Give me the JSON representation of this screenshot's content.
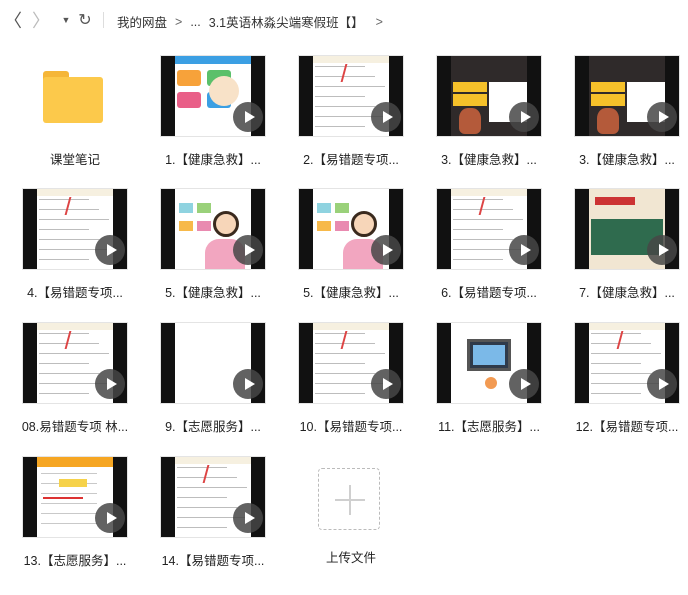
{
  "toolbar": {
    "back_glyph": "〈",
    "forward_glyph": "〉",
    "dropdown_glyph": "▼",
    "refresh_glyph": "↻"
  },
  "breadcrumb": {
    "root": "我的网盘",
    "sep1": ">",
    "ellipsis": "...",
    "current": "3.1英语林淼尖端寒假班【】",
    "sep2": ">"
  },
  "folder": {
    "label": "课堂笔记",
    "icon": "folder-icon"
  },
  "files": [
    {
      "label": "1.【健康急救】...",
      "theme": "infographic"
    },
    {
      "label": "2.【易错题专项...",
      "theme": "worksheet"
    },
    {
      "label": "3.【健康急救】...",
      "theme": "slide-dark"
    },
    {
      "label": "3.【健康急救】...",
      "theme": "slide-dark"
    },
    {
      "label": "4.【易错题专项...",
      "theme": "worksheet"
    },
    {
      "label": "5.【健康急救】...",
      "theme": "cartoon"
    },
    {
      "label": "5.【健康急救】...",
      "theme": "cartoon"
    },
    {
      "label": "6.【易错题专项...",
      "theme": "worksheet"
    },
    {
      "label": "7.【健康急救】...",
      "theme": "chalkboard"
    },
    {
      "label": "08.易错题专项 林...",
      "theme": "worksheet"
    },
    {
      "label": "9.【志愿服务】...",
      "theme": "blank"
    },
    {
      "label": "10.【易错题专项...",
      "theme": "worksheet"
    },
    {
      "label": "11.【志愿服务】...",
      "theme": "tv"
    },
    {
      "label": "12.【易错题专项...",
      "theme": "worksheet"
    },
    {
      "label": "13.【志愿服务】...",
      "theme": "notes"
    },
    {
      "label": "14.【易错题专项...",
      "theme": "worksheet"
    }
  ],
  "upload": {
    "label": "上传文件",
    "icon": "plus-icon"
  },
  "colors": {
    "folder": "#fcc94b",
    "play_overlay": "#464646"
  }
}
